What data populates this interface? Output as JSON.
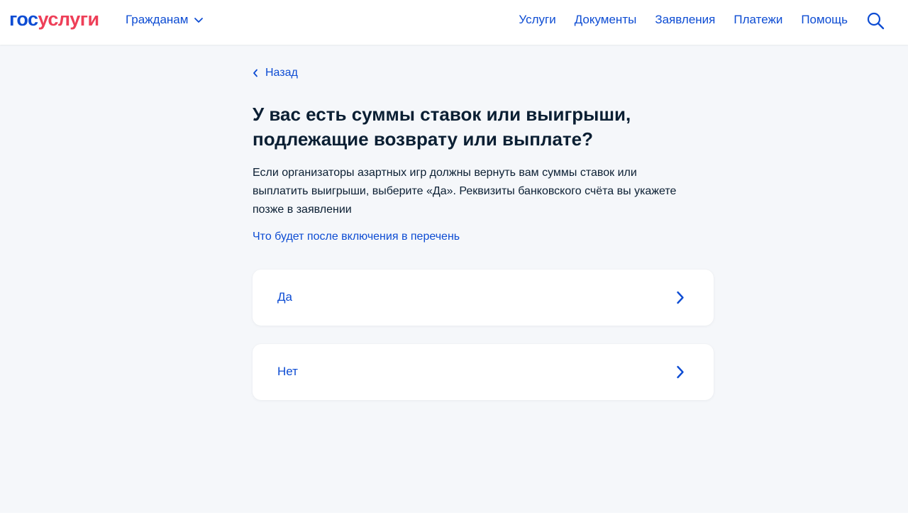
{
  "header": {
    "logo_part1": "гос",
    "logo_part2": "услуги",
    "audience_label": "Гражданам",
    "nav": [
      "Услуги",
      "Документы",
      "Заявления",
      "Платежи",
      "Помощь"
    ]
  },
  "main": {
    "back_label": "Назад",
    "title": "У вас есть суммы ставок или выигрыши, подлежащие возврату или выплате?",
    "description": "Если организаторы азартных игр должны вернуть вам суммы ставок или выплатить выигрыши, выберите «Да». Реквизиты банковского счёта вы укажете позже в заявлении",
    "info_link": "Что будет после включения в перечень",
    "options": [
      "Да",
      "Нет"
    ]
  },
  "colors": {
    "accent": "#0d4cd3",
    "brand_red": "#ee3f58",
    "background": "#f5f7fa",
    "text": "#0b1f33"
  },
  "icons": {
    "audience_dropdown": "chevron-down-icon",
    "search": "search-icon",
    "back": "chevron-left-icon",
    "option_arrow": "chevron-right-icon"
  }
}
